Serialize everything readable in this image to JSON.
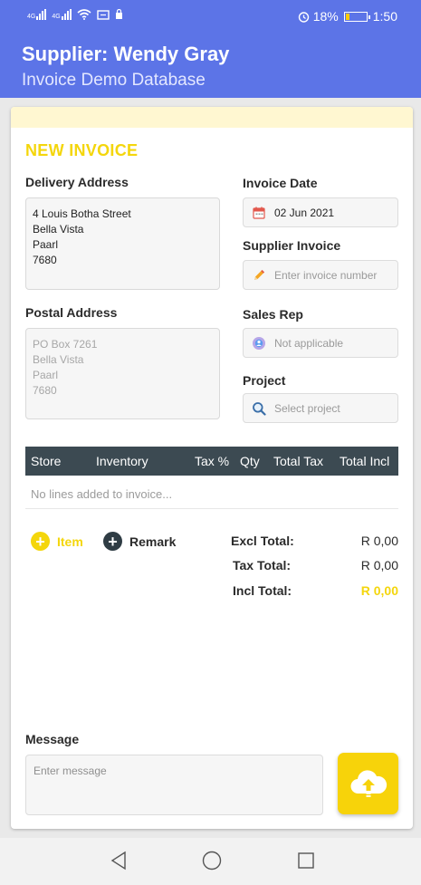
{
  "status_bar": {
    "network_labels": [
      "4G",
      "4G"
    ],
    "battery_percent": "18%",
    "battery_level": 0.18,
    "time": "1:50",
    "icons": [
      "signal-icon",
      "signal-icon",
      "wifi-icon",
      "cast-icon",
      "lock-icon",
      "alarm-icon",
      "battery-icon"
    ]
  },
  "app_bar": {
    "title": "Supplier: Wendy Gray",
    "subtitle": "Invoice Demo Database"
  },
  "invoice": {
    "heading": "NEW INVOICE",
    "delivery_address": {
      "label": "Delivery Address",
      "lines": [
        "4 Louis Botha Street",
        "Bella Vista",
        "Paarl",
        "7680"
      ]
    },
    "postal_address": {
      "label": "Postal Address",
      "lines": [
        "PO Box 7261",
        "Bella Vista",
        "Paarl",
        "7680"
      ]
    },
    "invoice_date": {
      "label": "Invoice Date",
      "value": "02 Jun 2021",
      "icon": "calendar-icon"
    },
    "supplier_invoice": {
      "label": "Supplier Invoice",
      "placeholder": "Enter invoice number",
      "icon": "pencil-icon"
    },
    "sales_rep": {
      "label": "Sales Rep",
      "value": "Not applicable",
      "icon": "person-icon"
    },
    "project": {
      "label": "Project",
      "placeholder": "Select project",
      "icon": "search-icon"
    },
    "table": {
      "columns": [
        "Store",
        "Inventory",
        "Tax %",
        "Qty",
        "Total Tax",
        "Total Incl"
      ],
      "empty_text": "No lines added to invoice..."
    },
    "actions": {
      "item_label": "Item",
      "remark_label": "Remark"
    },
    "totals": {
      "excl_label": "Excl Total:",
      "excl_value": "R 0,00",
      "tax_label": "Tax Total:",
      "tax_value": "R 0,00",
      "incl_label": "Incl Total:",
      "incl_value": "R 0,00"
    },
    "message": {
      "label": "Message",
      "placeholder": "Enter message"
    },
    "upload_icon": "cloud-upload-icon"
  },
  "nav_bar": {
    "icons": [
      "back-icon",
      "home-icon",
      "recents-icon"
    ]
  },
  "colors": {
    "primary": "#5c74e7",
    "accent": "#f4d60c",
    "table_header": "#3c4a52",
    "notice": "#fff7d1"
  }
}
